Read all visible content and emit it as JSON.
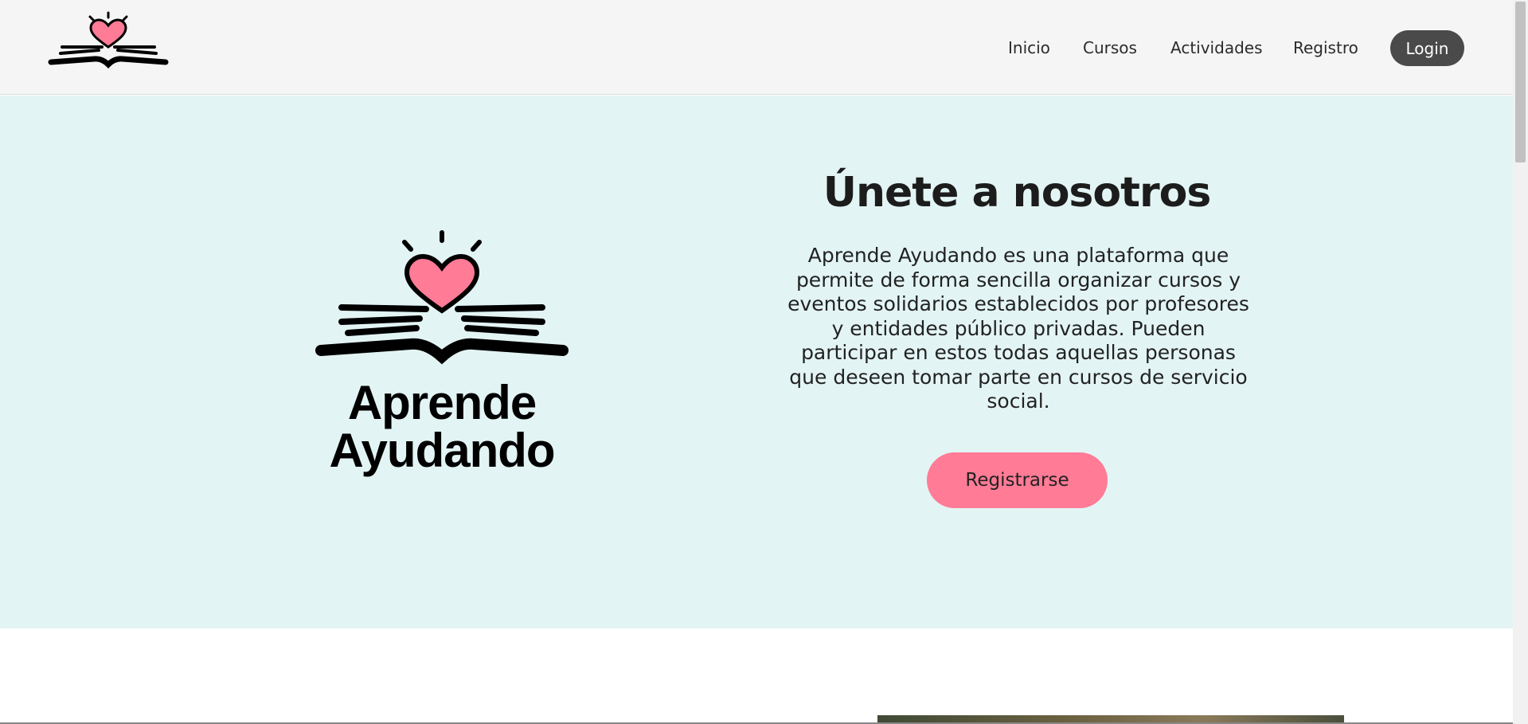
{
  "nav": {
    "logo_icon": "book-heart-logo",
    "links": [
      "Inicio",
      "Cursos",
      "Actividades",
      "Registro"
    ],
    "login_label": "Login"
  },
  "hero": {
    "logo_icon": "book-heart-logo",
    "brand_line1": "Aprende",
    "brand_line2": "Ayudando",
    "title": "Únete a nosotros",
    "description": "Aprende Ayudando es una plataforma que permite de forma sencilla organizar cursos y eventos solidarios establecidos por profesores y entidades público privadas. Pueden participar en estos todas aquellas personas que deseen tomar parte en cursos de servicio social.",
    "cta_label": "Registrarse"
  },
  "colors": {
    "hero_bg": "#e3f4f4",
    "heart": "#ff7b96",
    "login_bg": "#4a4a4a",
    "cta_bg": "#ff7b96"
  }
}
